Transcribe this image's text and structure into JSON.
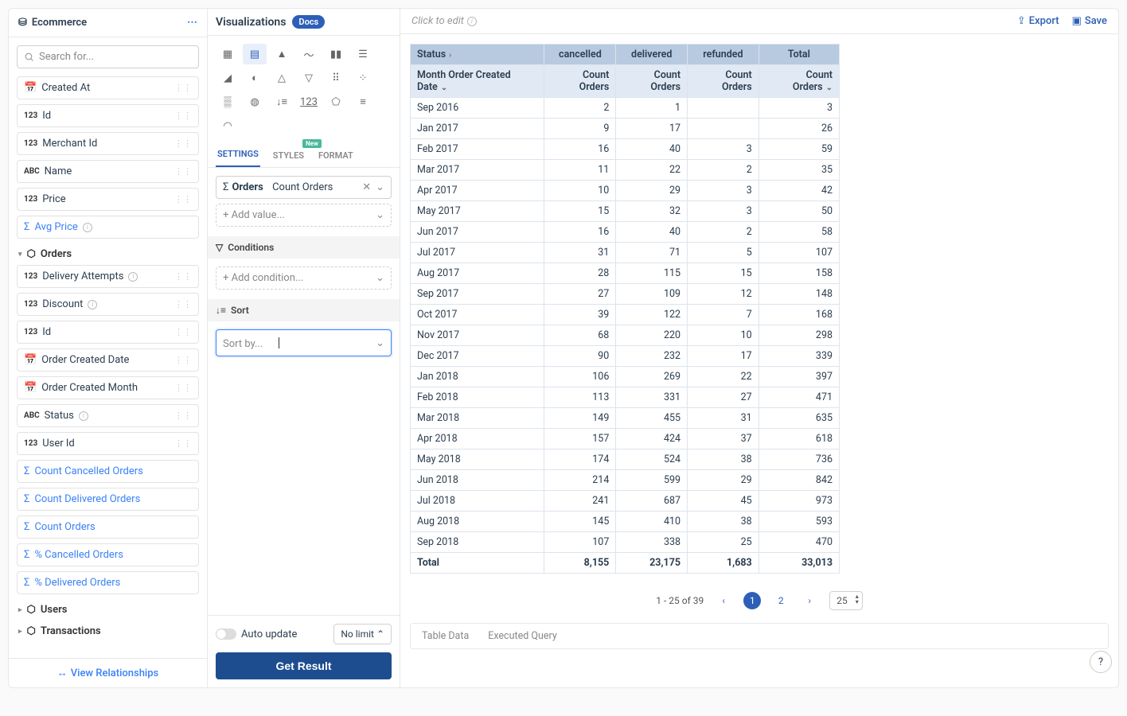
{
  "left": {
    "title": "Ecommerce",
    "search_placeholder": "Search for...",
    "fields_top": [
      {
        "type": "cal",
        "label": "Created At"
      },
      {
        "type": "123",
        "label": "Id"
      },
      {
        "type": "123",
        "label": "Merchant Id"
      },
      {
        "type": "ABC",
        "label": "Name"
      },
      {
        "type": "123",
        "label": "Price"
      }
    ],
    "avg_price": "Avg Price",
    "orders_group": "Orders",
    "orders_fields": [
      {
        "type": "123",
        "label": "Delivery Attempts",
        "info": true
      },
      {
        "type": "123",
        "label": "Discount",
        "info": true
      },
      {
        "type": "123",
        "label": "Id"
      },
      {
        "type": "cal",
        "label": "Order Created Date"
      },
      {
        "type": "cal",
        "label": "Order Created Month"
      },
      {
        "type": "ABC",
        "label": "Status",
        "info": true
      },
      {
        "type": "123",
        "label": "User Id"
      }
    ],
    "measures": [
      "Count Cancelled Orders",
      "Count Delivered Orders",
      "Count Orders",
      "% Cancelled Orders",
      "% Delivered Orders"
    ],
    "groups": [
      "Users",
      "Transactions"
    ],
    "footer": "View Relationships"
  },
  "mid": {
    "title": "Visualizations",
    "docs": "Docs",
    "tabs": {
      "settings": "SETTINGS",
      "styles": "STYLES",
      "format": "FORMAT",
      "new": "New"
    },
    "value": {
      "prefix": "Orders",
      "label": "Count Orders"
    },
    "add_value": "+ Add value...",
    "conditions": "Conditions",
    "add_condition": "+ Add condition...",
    "sort": "Sort",
    "sort_placeholder": "Sort by...",
    "auto_update": "Auto update",
    "no_limit": "No limit",
    "get_result": "Get Result"
  },
  "main": {
    "click_edit": "Click to edit",
    "export": "Export",
    "save": "Save",
    "status": "Status",
    "month_header": "Month Order Created Date",
    "cols": [
      "cancelled",
      "delivered",
      "refunded",
      "Total"
    ],
    "sub": "Count Orders",
    "pager_text": "1 - 25 of 39",
    "page_size": "25",
    "bottom_tabs": [
      "Table Data",
      "Executed Query"
    ]
  },
  "chart_data": {
    "type": "table",
    "row_header": "Month Order Created Date",
    "columns": [
      "cancelled",
      "delivered",
      "refunded",
      "Total"
    ],
    "rows": [
      {
        "m": "Sep 2016",
        "c": 2,
        "d": 1,
        "r": null,
        "t": 3
      },
      {
        "m": "Jan 2017",
        "c": 9,
        "d": 17,
        "r": null,
        "t": 26
      },
      {
        "m": "Feb 2017",
        "c": 16,
        "d": 40,
        "r": 3,
        "t": 59
      },
      {
        "m": "Mar 2017",
        "c": 11,
        "d": 22,
        "r": 2,
        "t": 35
      },
      {
        "m": "Apr 2017",
        "c": 10,
        "d": 29,
        "r": 3,
        "t": 42
      },
      {
        "m": "May 2017",
        "c": 15,
        "d": 32,
        "r": 3,
        "t": 50
      },
      {
        "m": "Jun 2017",
        "c": 16,
        "d": 40,
        "r": 2,
        "t": 58
      },
      {
        "m": "Jul 2017",
        "c": 31,
        "d": 71,
        "r": 5,
        "t": 107
      },
      {
        "m": "Aug 2017",
        "c": 28,
        "d": 115,
        "r": 15,
        "t": 158
      },
      {
        "m": "Sep 2017",
        "c": 27,
        "d": 109,
        "r": 12,
        "t": 148
      },
      {
        "m": "Oct 2017",
        "c": 39,
        "d": 122,
        "r": 7,
        "t": 168
      },
      {
        "m": "Nov 2017",
        "c": 68,
        "d": 220,
        "r": 10,
        "t": 298
      },
      {
        "m": "Dec 2017",
        "c": 90,
        "d": 232,
        "r": 17,
        "t": 339
      },
      {
        "m": "Jan 2018",
        "c": 106,
        "d": 269,
        "r": 22,
        "t": 397
      },
      {
        "m": "Feb 2018",
        "c": 113,
        "d": 331,
        "r": 27,
        "t": 471
      },
      {
        "m": "Mar 2018",
        "c": 149,
        "d": 455,
        "r": 31,
        "t": 635
      },
      {
        "m": "Apr 2018",
        "c": 157,
        "d": 424,
        "r": 37,
        "t": 618
      },
      {
        "m": "May 2018",
        "c": 174,
        "d": 524,
        "r": 38,
        "t": 736
      },
      {
        "m": "Jun 2018",
        "c": 214,
        "d": 599,
        "r": 29,
        "t": 842
      },
      {
        "m": "Jul 2018",
        "c": 241,
        "d": 687,
        "r": 45,
        "t": 973
      },
      {
        "m": "Aug 2018",
        "c": 145,
        "d": 410,
        "r": 38,
        "t": 593
      },
      {
        "m": "Sep 2018",
        "c": 107,
        "d": 338,
        "r": 25,
        "t": 470
      }
    ],
    "totals": {
      "m": "Total",
      "c": "8,155",
      "d": "23,175",
      "r": "1,683",
      "t": "33,013"
    }
  }
}
